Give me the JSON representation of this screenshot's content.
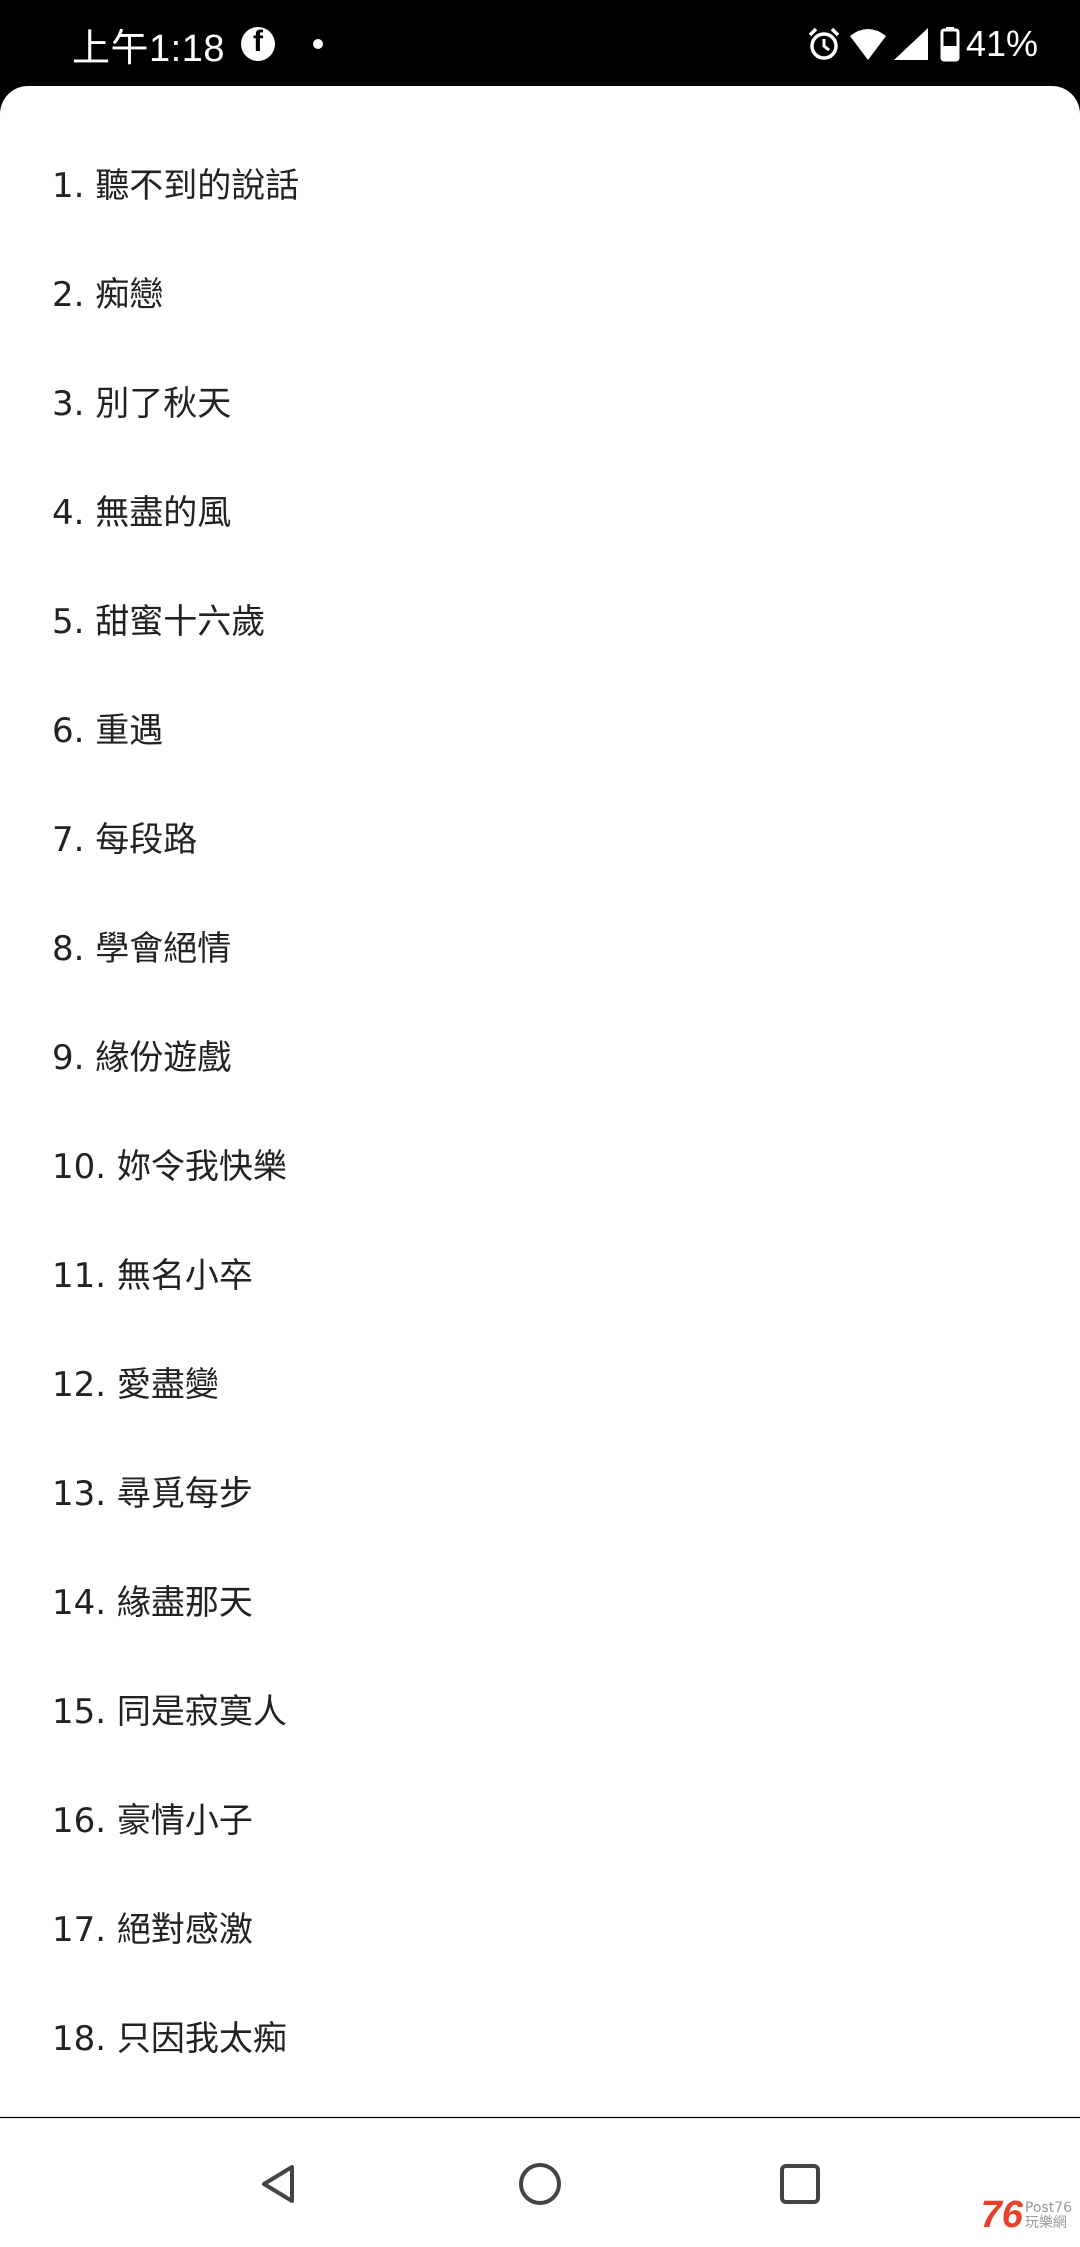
{
  "status_bar": {
    "time": "上午1:18",
    "battery": "41%",
    "icons": [
      "facebook-icon",
      "notification-dot-icon",
      "alarm-icon",
      "wifi-icon",
      "signal-icon",
      "battery-icon"
    ]
  },
  "list": {
    "items": [
      "1. 聽不到的說話",
      "2. 痴戀",
      "3. 別了秋天",
      "4. 無盡的風",
      "5. 甜蜜十六歲",
      "6. 重遇",
      "7. 每段路",
      "8. 學會絕情",
      "9. 緣份遊戲",
      "10. 妳令我快樂",
      "11. 無名小卒",
      "12. 愛盡變",
      "13. 尋覓每步",
      "14. 緣盡那天",
      "15. 同是寂寞人",
      "16. 豪情小子",
      "17. 絕對感激",
      "18. 只因我太痴"
    ]
  },
  "nav_bar": {
    "buttons": [
      "back-icon",
      "home-icon",
      "recents-icon"
    ]
  },
  "watermark": {
    "number": "76",
    "line1": "Post76",
    "line2": "玩樂網"
  }
}
